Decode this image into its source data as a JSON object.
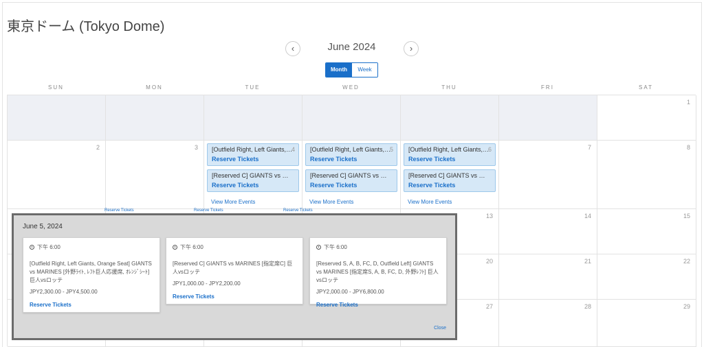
{
  "venue_title": "東京ドーム (Tokyo Dome)",
  "nav": {
    "prev_label": "‹",
    "next_label": "›",
    "month_label": "June 2024"
  },
  "view_toggle": {
    "month_label": "Month",
    "week_label": "Week"
  },
  "weekdays": [
    "SUN",
    "MON",
    "TUE",
    "WED",
    "THU",
    "FRI",
    "SAT"
  ],
  "weeks": [
    {
      "days": [
        "",
        "",
        "",
        "",
        "",
        "",
        "1"
      ]
    },
    {
      "days": [
        "2",
        "3",
        "4",
        "5",
        "6",
        "7",
        "8"
      ]
    },
    {
      "days": [
        "",
        "",
        "",
        "",
        "13",
        "14",
        "15"
      ]
    },
    {
      "days": [
        "",
        "",
        "",
        "",
        "20",
        "21",
        "22"
      ]
    },
    {
      "days": [
        "",
        "",
        "",
        "",
        "27",
        "28",
        "29"
      ]
    }
  ],
  "week2_events": {
    "tue": {
      "count": "4",
      "e1": "[Outfield Right, Left Giants, Or...",
      "e2": "[Reserved C] GIANTS vs MARI...",
      "reserve": "Reserve Tickets",
      "more": "View More Events"
    },
    "wed": {
      "count": "5",
      "e1": "[Outfield Right, Left Giants, Or...",
      "e2": "[Reserved C] GIANTS vs MARI...",
      "reserve": "Reserve Tickets",
      "more": "View More Events"
    },
    "thu": {
      "count": "6",
      "e1": "[Outfield Right, Left Giants, Or...",
      "e2": "[Reserved C] GIANTS vs MARI...",
      "reserve": "Reserve Tickets",
      "more": "View More Events"
    }
  },
  "peek_label": "Reserve Tickets",
  "popup": {
    "date": "June 5, 2024",
    "close_label": "Close",
    "events": [
      {
        "time": "下午 6:00",
        "name": "[Outfield Right, Left Giants, Orange Seat] GIANTS vs MARINES [外野ﾗｲﾄ, ﾚﾌﾄ巨人応援席, ｵﾚﾝｼﾞｼｰﾄ] 巨人vsロッテ",
        "price": "JPY2,300.00 - JPY4,500.00",
        "reserve": "Reserve Tickets"
      },
      {
        "time": "下午 6:00",
        "name": "[Reserved C] GIANTS vs MARINES [指定席C] 巨人vsロッテ",
        "price": "JPY1,000.00 - JPY2,200.00",
        "reserve": "Reserve Tickets"
      },
      {
        "time": "下午 6:00",
        "name": "[Reserved S, A, B, FC, D, Outfield Left] GIANTS vs MARINES [指定席S, A, B, FC, D, 外野ﾚﾌﾄ] 巨人vsロッテ",
        "price": "JPY2,000.00 - JPY6,800.00",
        "reserve": "Reserve Tickets"
      }
    ]
  }
}
